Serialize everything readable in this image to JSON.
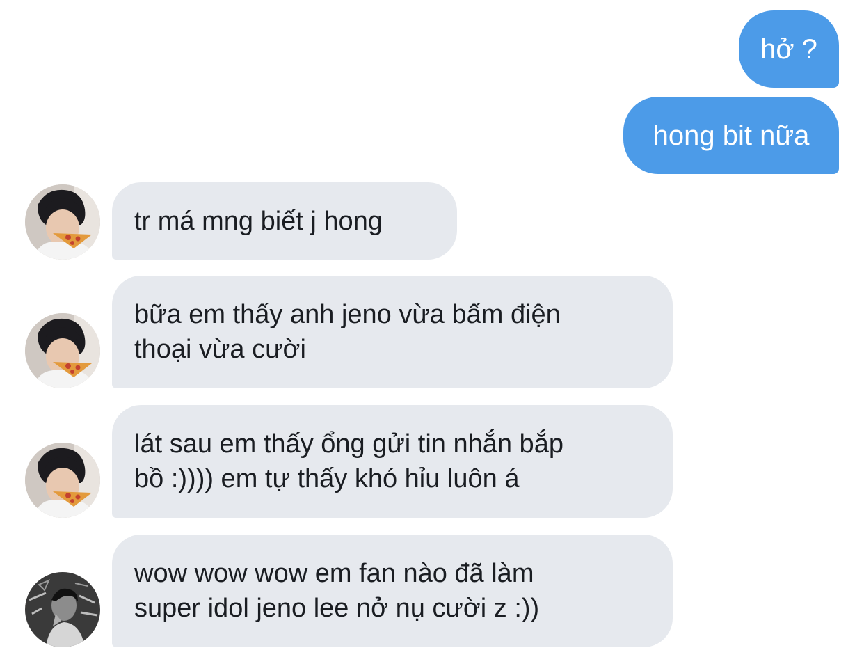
{
  "conversation": {
    "outgoing": [
      {
        "text": "hở ?"
      },
      {
        "text": "hong bit nữa"
      }
    ],
    "incoming": [
      {
        "text": "tr má mng biết j hong",
        "avatar": "pizza-boy-avatar"
      },
      {
        "text": "bữa em thấy anh jeno vừa bấm điện\nthoại vừa cười",
        "avatar": "pizza-boy-avatar"
      },
      {
        "text": "lát sau em thấy ổng gửi tin nhắn bắp\nbồ :)))) em tự thấy khó hỉu luôn á",
        "avatar": "pizza-boy-avatar"
      },
      {
        "text": "wow wow wow em fan nào đã làm\nsuper idol jeno lee nở nụ cười z :))",
        "avatar": "grayscale-graffiti-avatar"
      }
    ]
  },
  "colors": {
    "outgoing_bubble": "#4c9be8",
    "incoming_bubble": "#e6e9ee",
    "incoming_text": "#1a1d22",
    "background": "#ffffff"
  }
}
